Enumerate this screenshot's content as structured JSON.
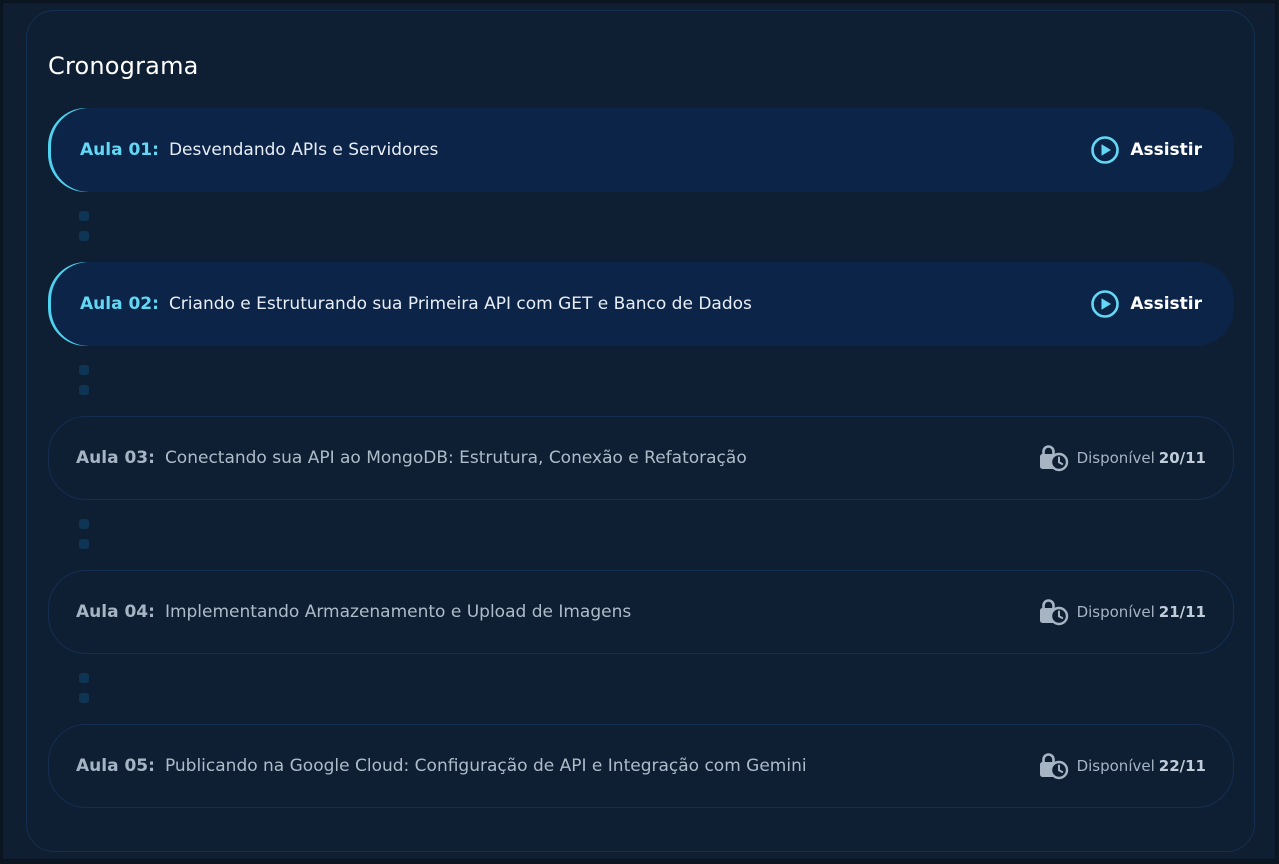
{
  "schedule": {
    "title": "Cronograma",
    "lessons": [
      {
        "label": "Aula 01:",
        "name": "Desvendando APIs e Servidores",
        "action": "Assistir"
      },
      {
        "label": "Aula 02:",
        "name": "Criando e Estruturando sua Primeira API com GET e Banco de Dados",
        "action": "Assistir"
      },
      {
        "label": "Aula 03:",
        "name": "Conectando sua API ao MongoDB: Estrutura, Conexão e Refatoração",
        "status": "Disponível",
        "date": "20/11"
      },
      {
        "label": "Aula 04:",
        "name": "Implementando Armazenamento e Upload de Imagens",
        "status": "Disponível",
        "date": "21/11"
      },
      {
        "label": "Aula 05:",
        "name": "Publicando na Google Cloud: Configuração de API e Integração com Gemini",
        "status": "Disponível",
        "date": "22/11"
      }
    ]
  },
  "icons": {
    "play": "play-circle-icon",
    "locked": "lock-clock-icon"
  },
  "colors": {
    "accent": "#63d8f5",
    "available_bg": "#0c2447",
    "locked_border": "#142e52",
    "panel_bg": "#0f1f33"
  }
}
